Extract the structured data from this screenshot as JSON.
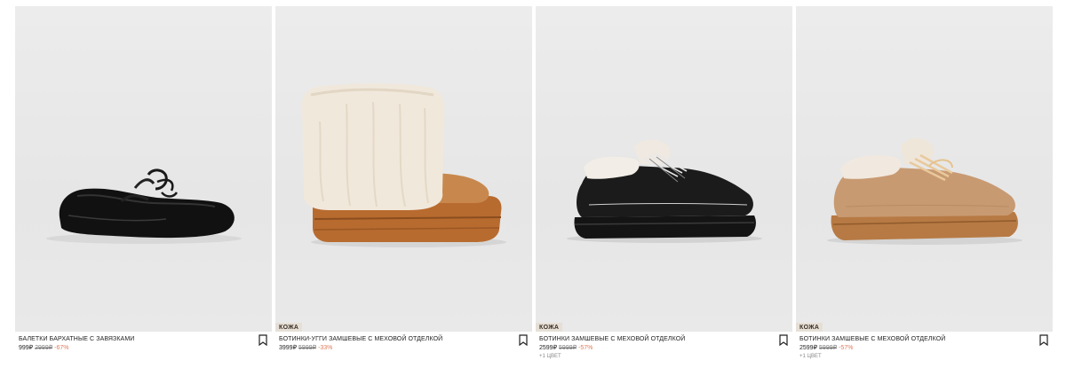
{
  "products": [
    {
      "title": "Балетки бархатные с завязками",
      "price_now": "999₽",
      "price_old": "2999₽",
      "discount": "-67%",
      "badge": "",
      "colors_more": "",
      "image": "black-velvet-ballet-flat"
    },
    {
      "title": "Ботинки-угги замшевые с меховой отделкой",
      "price_now": "3999₽",
      "price_old": "5999₽",
      "discount": "-33%",
      "badge": "КОЖА",
      "colors_more": "",
      "image": "tan-fur-cuff-boot"
    },
    {
      "title": "Ботинки замшевые с меховой отделкой",
      "price_now": "2599₽",
      "price_old": "5999₽",
      "discount": "-57%",
      "badge": "КОЖА",
      "colors_more": "+1 ЦВЕТ",
      "image": "black-suede-fur-sneaker"
    },
    {
      "title": "Ботинки замшевые с меховой отделкой",
      "price_now": "2599₽",
      "price_old": "5999₽",
      "discount": "-57%",
      "badge": "КОЖА",
      "colors_more": "+1 ЦВЕТ",
      "image": "tan-suede-fur-sneaker"
    }
  ],
  "colors": {
    "discount": "#e07b5a",
    "badge_bg": "#e6dfd6"
  },
  "icons": {
    "bookmark": "bookmark-icon"
  }
}
